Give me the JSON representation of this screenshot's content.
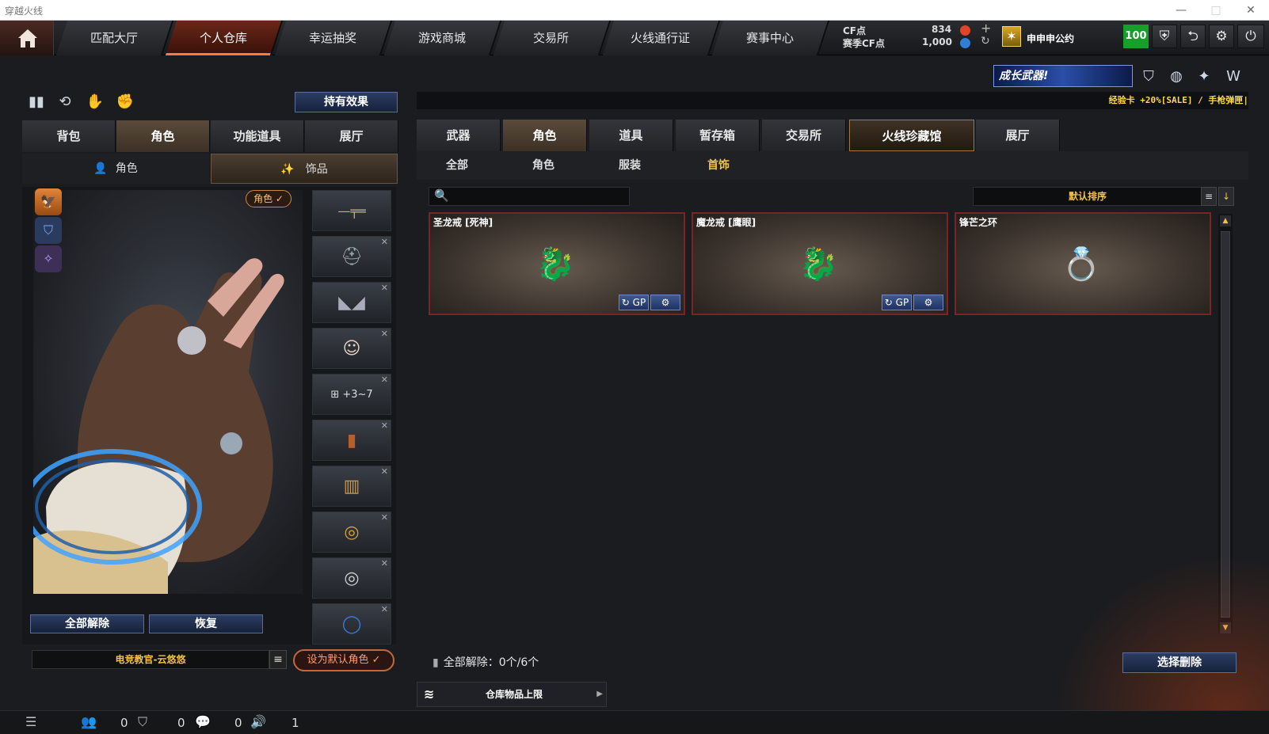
{
  "window": {
    "title": "穿越火线",
    "controls": [
      "—",
      "□",
      "✕"
    ]
  },
  "topnav": {
    "tabs": [
      "匹配大厅",
      "个人仓库",
      "幸运抽奖",
      "游戏商城",
      "交易所",
      "火线通行证",
      "赛事中心"
    ],
    "active_tab": "个人仓库",
    "cf_label": "CF点",
    "season_cf_label": "赛季CF点",
    "cf_value": "834",
    "season_cf_value": "1,000",
    "add_icon": "+",
    "refresh_icon": "↻",
    "username": "申申申公约",
    "rank_icon": "✶",
    "level": "100",
    "icons": [
      "shield-icon",
      "exit-icon",
      "gear-icon",
      "power-icon"
    ]
  },
  "left": {
    "effect_button": "持有效果",
    "tabs": [
      "背包",
      "角色",
      "功能道具",
      "展厅"
    ],
    "active_tab": "角色",
    "subtabs": [
      "角色",
      "饰品"
    ],
    "role_badge": "角色 ✓",
    "unequip_all": "全部解除",
    "restore": "恢复",
    "default_character": "电竞教官-云悠悠",
    "set_default": "设为默认角色 ✓",
    "slots": [
      {
        "name": "sniper-rifle",
        "icon": "—╤═"
      },
      {
        "name": "helmet",
        "icon": "⛑"
      },
      {
        "name": "goggles",
        "icon": "◣◢"
      },
      {
        "name": "character",
        "icon": "☺"
      },
      {
        "name": "backpack",
        "icon": "⊞ +3~7"
      },
      {
        "name": "holster",
        "icon": "▮"
      },
      {
        "name": "ammo-pouch",
        "icon": "▥"
      },
      {
        "name": "ring-gold-dragon",
        "icon": "◎"
      },
      {
        "name": "ring-silver-dragon",
        "icon": "◎"
      },
      {
        "name": "ring-blue",
        "icon": "◯"
      }
    ]
  },
  "right": {
    "banner": "成长武器!",
    "promo": "经验卡 +20%[SALE] / 手枪弹匣|",
    "tabs": [
      "武器",
      "角色",
      "道具",
      "暂存箱",
      "交易所",
      "火线珍藏馆",
      "展厅"
    ],
    "active_tab": "角色",
    "subtabs": [
      "全部",
      "角色",
      "服装",
      "首饰"
    ],
    "active_subtab": "首饰",
    "search_placeholder": "",
    "sort_label": "默认排序",
    "items": [
      {
        "name": "圣龙戒 [死神]",
        "color": "#d6a23a",
        "has_buttons": true
      },
      {
        "name": "魔龙戒 [鹰眼]",
        "color": "#cfcfcf",
        "has_buttons": true
      },
      {
        "name": "锋芒之环",
        "color": "#3a7bd6",
        "has_buttons": false
      }
    ],
    "card_btn_gp": "↻ GP",
    "card_btn_settings": "⚙",
    "unequip_info": "全部解除：0个/6个",
    "select_delete": "选择删除",
    "storage_limit": "仓库物品上限"
  },
  "footer": {
    "count1": "0",
    "count2": "0",
    "count3": "0",
    "count4": "1"
  }
}
